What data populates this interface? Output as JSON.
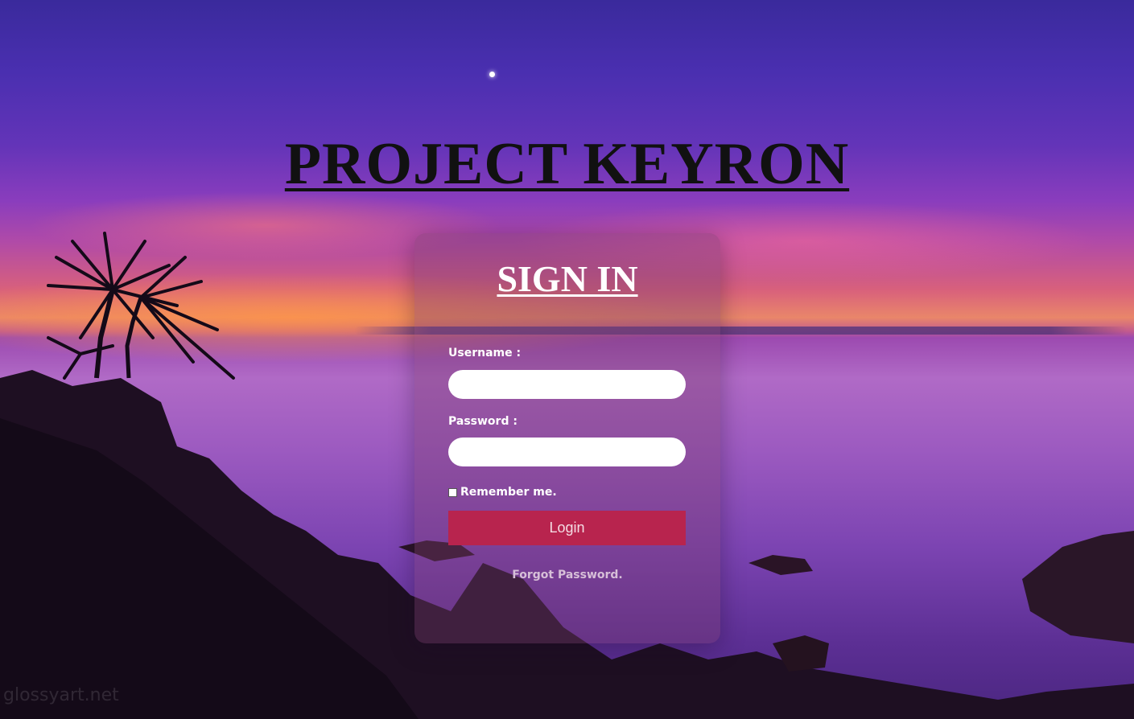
{
  "page": {
    "title": "PROJECT KEYRON",
    "watermark": "glossyart.net"
  },
  "signin": {
    "heading": "SIGN IN",
    "username_label": "Username :",
    "username_value": "",
    "password_label": "Password :",
    "password_value": "",
    "remember_label": "Remember me.",
    "remember_checked": false,
    "login_label": "Login",
    "forgot_label": "Forgot Password."
  },
  "colors": {
    "login_button": "#b8244e",
    "title_text": "#111111",
    "heading_text": "#ffffff"
  }
}
